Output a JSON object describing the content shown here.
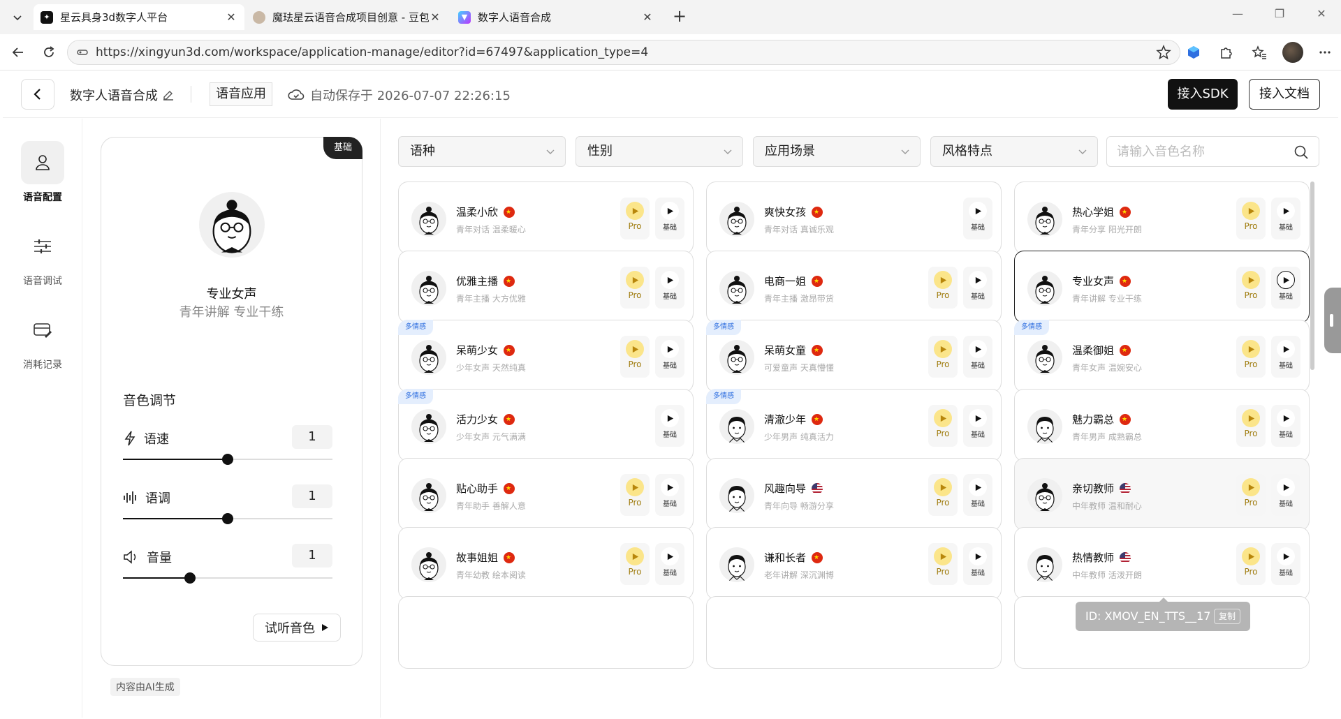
{
  "browser": {
    "tabs": [
      {
        "title": "星云具身3d数字人平台",
        "favicon": "xingyun-logo",
        "active": true
      },
      {
        "title": "魔珐星云语音合成项目创意 - 豆包",
        "favicon": "doubao-avatar",
        "active": false
      },
      {
        "title": "数字人语音合成",
        "favicon": "vite-logo",
        "active": false
      }
    ],
    "url": "https://xingyun3d.com/workspace/application-manage/editor?id=67497&application_type=4"
  },
  "header": {
    "title": "数字人语音合成",
    "app_type": "语音应用",
    "autosave": "自动保存于 2026-07-07 22:26:15",
    "sdk_button": "接入SDK",
    "doc_button": "接入文档"
  },
  "sidebar": {
    "items": [
      {
        "label": "语音配置",
        "icon": "user-icon",
        "active": true
      },
      {
        "label": "语音调试",
        "icon": "sliders-icon",
        "active": false
      },
      {
        "label": "消耗记录",
        "icon": "wallet-icon",
        "active": false
      }
    ]
  },
  "config": {
    "badge": "基础",
    "voice_name": "专业女声",
    "voice_desc": "青年讲解 专业干练",
    "adjust_title": "音色调节",
    "speed": {
      "label": "语速",
      "value": "1",
      "level": 0.5
    },
    "pitch": {
      "label": "语调",
      "value": "1",
      "level": 0.5
    },
    "volume": {
      "label": "音量",
      "value": "1",
      "level": 0.32
    },
    "try_button": "试听音色",
    "ai_note": "内容由AI生成"
  },
  "filters": {
    "language": "语种",
    "gender": "性别",
    "scene": "应用场景",
    "style": "风格特点",
    "search_placeholder": "请输入音色名称"
  },
  "pro_label": "Pro",
  "base_label": "基础",
  "multi_label": "多情感",
  "voices": [
    {
      "name": "温柔小欣",
      "desc": "青年对话 温柔暖心",
      "flag": "cn",
      "gender": "f",
      "pro": true,
      "multi": false
    },
    {
      "name": "爽快女孩",
      "desc": "青年对话 真诚乐观",
      "flag": "cn",
      "gender": "f",
      "pro": false,
      "multi": false
    },
    {
      "name": "热心学姐",
      "desc": "青年分享 阳光开朗",
      "flag": "cn",
      "gender": "f",
      "pro": true,
      "multi": false
    },
    {
      "name": "优雅主播",
      "desc": "青年主播 大方优雅",
      "flag": "cn",
      "gender": "f",
      "pro": true,
      "multi": false
    },
    {
      "name": "电商一姐",
      "desc": "青年主播 激昂带货",
      "flag": "cn",
      "gender": "f",
      "pro": true,
      "multi": false
    },
    {
      "name": "专业女声",
      "desc": "青年讲解 专业干练",
      "flag": "cn",
      "gender": "f",
      "pro": true,
      "multi": false,
      "selected": true
    },
    {
      "name": "呆萌少女",
      "desc": "少年女声 天然纯真",
      "flag": "cn",
      "gender": "f",
      "pro": true,
      "multi": true
    },
    {
      "name": "呆萌女童",
      "desc": "可爱童声 天真懵懂",
      "flag": "cn",
      "gender": "f",
      "pro": true,
      "multi": true
    },
    {
      "name": "温柔御姐",
      "desc": "青年女声 温婉安心",
      "flag": "cn",
      "gender": "f",
      "pro": true,
      "multi": true
    },
    {
      "name": "活力少女",
      "desc": "少年女声 元气满满",
      "flag": "cn",
      "gender": "f",
      "pro": false,
      "multi": true
    },
    {
      "name": "清澈少年",
      "desc": "少年男声 纯真活力",
      "flag": "cn",
      "gender": "m",
      "pro": true,
      "multi": true
    },
    {
      "name": "魅力霸总",
      "desc": "青年男声 成熟霸总",
      "flag": "cn",
      "gender": "m",
      "pro": true,
      "multi": false
    },
    {
      "name": "贴心助手",
      "desc": "青年助手 善解人意",
      "flag": "cn",
      "gender": "f",
      "pro": true,
      "multi": false
    },
    {
      "name": "风趣向导",
      "desc": "青年向导 畅游分享",
      "flag": "us",
      "gender": "m",
      "pro": true,
      "multi": false
    },
    {
      "name": "亲切教师",
      "desc": "中年教师 温和耐心",
      "flag": "us",
      "gender": "f",
      "pro": true,
      "multi": false,
      "hover": true
    },
    {
      "name": "故事姐姐",
      "desc": "青年幼教 绘本阅读",
      "flag": "cn",
      "gender": "f",
      "pro": true,
      "multi": false
    },
    {
      "name": "谦和长者",
      "desc": "老年讲解 深沉渊博",
      "flag": "cn",
      "gender": "m",
      "pro": true,
      "multi": false
    },
    {
      "name": "热情教师",
      "desc": "中年教师 活泼开朗",
      "flag": "us",
      "gender": "m",
      "pro": true,
      "multi": false
    }
  ],
  "tooltip": {
    "text": "ID: XMOV_EN_TTS__17",
    "copy": "复制"
  }
}
